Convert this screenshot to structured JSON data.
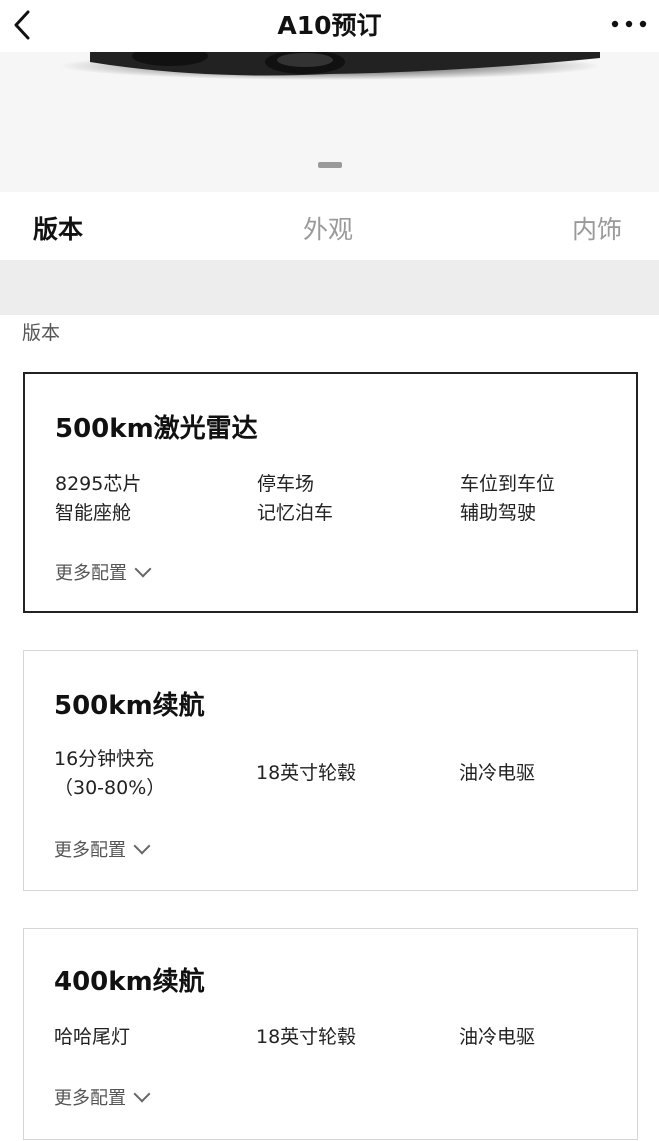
{
  "header": {
    "title": "A10预订"
  },
  "tabs": [
    {
      "label": "版本"
    },
    {
      "label": "外观"
    },
    {
      "label": "内饰"
    }
  ],
  "section_label": "版本",
  "more_label": "更多配置",
  "cards": [
    {
      "title": "500km激光雷达",
      "features": [
        [
          "8295芯片",
          "智能座舱"
        ],
        [
          "停车场",
          "记忆泊车"
        ],
        [
          "车位到车位",
          "辅助驾驶"
        ]
      ],
      "selected": true
    },
    {
      "title": "500km续航",
      "features": [
        [
          "16分钟快充",
          "（30-80%）"
        ],
        [
          "18英寸轮毂"
        ],
        [
          "油冷电驱"
        ]
      ],
      "selected": false
    },
    {
      "title": "400km续航",
      "features": [
        [
          "哈哈尾灯"
        ],
        [
          "18英寸轮毂"
        ],
        [
          "油冷电驱"
        ]
      ],
      "selected": false
    }
  ]
}
